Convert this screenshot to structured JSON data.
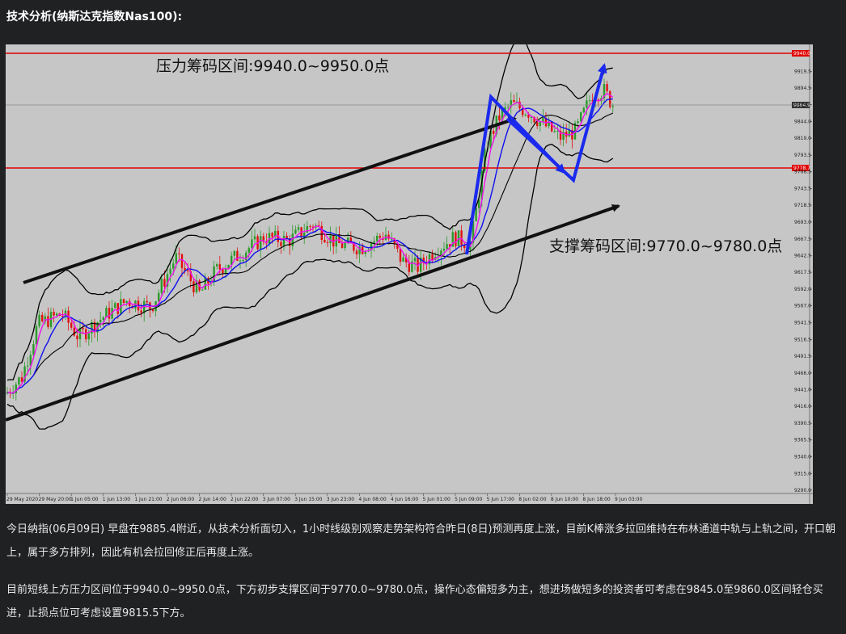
{
  "page": {
    "heading": "技术分析(纳斯达克指数Nas100):",
    "paragraphs": [
      "今日纳指(06月09日) 早盘在9885.4附近，从技术分析面切入，1小时线级别观察走势架构符合昨日(8日)预测再度上涨，目前K棒涨多拉回维持在布林通道中轨与上轨之间，开口朝上，属于多方排列，因此有机会拉回修正后再度上涨。",
      "目前短线上方压力区间位于9940.0~9950.0点，下方初步支撑区间于9770.0~9780.0点，操作心态偏短多为主，想进场做短多的投资者可考虑在9845.0至9860.0区间轻仓买进，止损点位可考虑设置9815.5下方。"
    ]
  },
  "chart_data": {
    "type": "candlestick",
    "annotations": {
      "resistance": "压力筹码区间:9940.0~9950.0点",
      "support": "支撑筹码区间:9770.0~9780.0点"
    },
    "ylim": [
      9285,
      9960
    ],
    "y_ticks": [
      "9919.5",
      "9894.5",
      "9869.5",
      "9844.0",
      "9819.0",
      "9793.5",
      "9768.5",
      "9743.5",
      "9718.5",
      "9693.0",
      "9667.5",
      "9642.5",
      "9617.5",
      "9592.0",
      "9567.0",
      "9541.5",
      "9516.5",
      "9491.5",
      "9466.0",
      "9441.0",
      "9416.0",
      "9390.5",
      "9365.5",
      "9340.0",
      "9315.0",
      "9290.0"
    ],
    "x_ticks": [
      "29 May 2020",
      "29 May 20:00",
      "1 Jun 05:00",
      "1 Jun 13:00",
      "1 Jun 21:00",
      "2 Jun 06:00",
      "2 Jun 14:00",
      "2 Jun 22:00",
      "3 Jun 07:00",
      "3 Jun 15:00",
      "3 Jun 23:00",
      "4 Jun 08:00",
      "4 Jun 16:00",
      "5 Jun 01:00",
      "5 Jun 09:00",
      "5 Jun 17:00",
      "8 Jun 02:00",
      "8 Jun 10:00",
      "8 Jun 18:00",
      "9 Jun 03:00"
    ],
    "price_labels": {
      "resistance_line": "9940.0",
      "support_line": "9778.7",
      "current_price": "9864.9"
    },
    "colors": {
      "background": "#c6c6c6",
      "bull_candle": "#2a9a2a",
      "bear_candle": "#e01010",
      "level_line": "#e00000",
      "blue_ma": "#1010ee",
      "pink_ma": "#ee10ee",
      "bollinger": "#000000",
      "arrow": "#1a2aee"
    }
  }
}
